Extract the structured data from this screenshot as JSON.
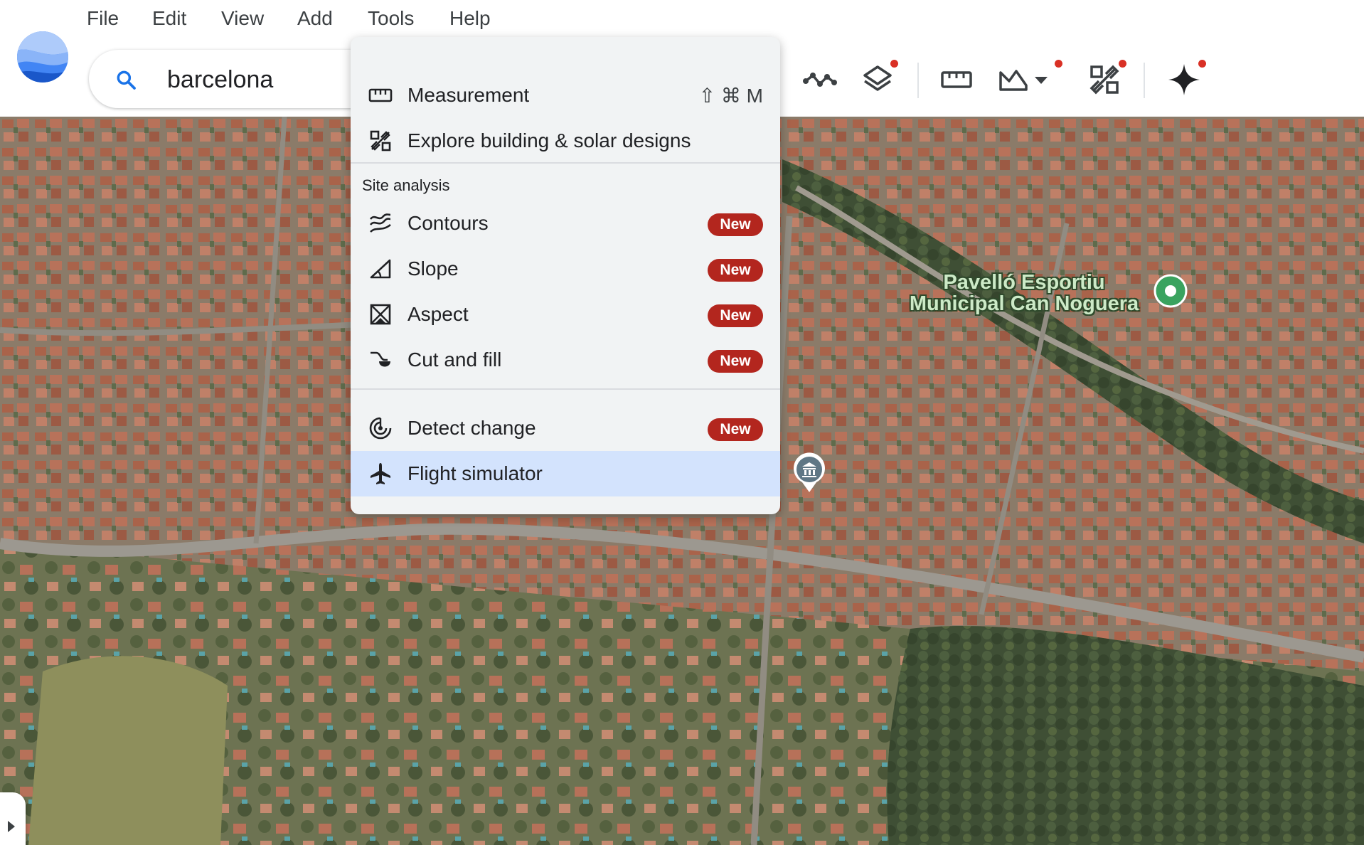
{
  "menubar": {
    "items": [
      "File",
      "Edit",
      "View",
      "Add",
      "Tools",
      "Help"
    ]
  },
  "search": {
    "value": "barcelona"
  },
  "toolbar": {
    "icons": [
      "path-icon",
      "layers-icon",
      "ruler-icon",
      "terrain-icon",
      "building-solar-icon",
      "sparkle-icon"
    ],
    "accent_dot_color": "#d93025"
  },
  "tools_menu": {
    "measurement": {
      "label": "Measurement",
      "shortcut": "⇧ ⌘ M"
    },
    "explore": {
      "label": "Explore building & solar designs"
    },
    "section_header": "Site analysis",
    "items": [
      {
        "label": "Contours",
        "badge": "New"
      },
      {
        "label": "Slope",
        "badge": "New"
      },
      {
        "label": "Aspect",
        "badge": "New"
      },
      {
        "label": "Cut and fill",
        "badge": "New"
      }
    ],
    "detect_change": {
      "label": "Detect change",
      "badge": "New"
    },
    "flight_simulator": {
      "label": "Flight simulator",
      "selected": true
    },
    "badge_color": "#b3261e",
    "selected_color": "#d3e3fd"
  },
  "map": {
    "poi_label": "Pavelló Esportiu Municipal Can Noguera"
  }
}
